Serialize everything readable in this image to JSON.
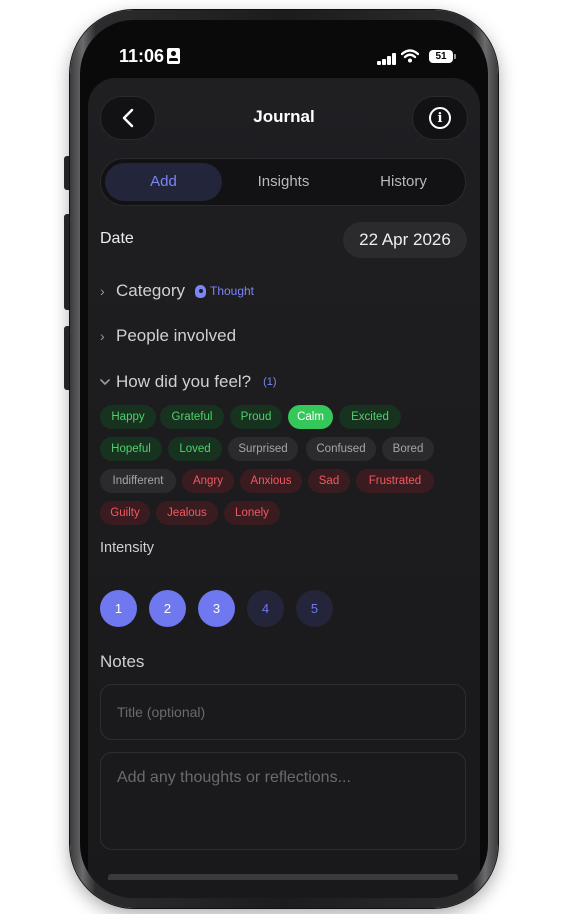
{
  "status_bar": {
    "time": "11:06",
    "battery": "51"
  },
  "header": {
    "title": "Journal"
  },
  "tabs": [
    {
      "label": "Add",
      "active": true
    },
    {
      "label": "Insights",
      "active": false
    },
    {
      "label": "History",
      "active": false
    }
  ],
  "date": {
    "label": "Date",
    "value": "22 Apr 2026"
  },
  "category": {
    "label": "Category",
    "badge": "Thought"
  },
  "people": {
    "label": "People involved"
  },
  "feelings": {
    "label": "How did you feel?",
    "count": "(1)",
    "options": [
      {
        "label": "Happy",
        "tone": "positive",
        "selected": false
      },
      {
        "label": "Grateful",
        "tone": "positive",
        "selected": false
      },
      {
        "label": "Proud",
        "tone": "positive",
        "selected": false
      },
      {
        "label": "Calm",
        "tone": "positive",
        "selected": true
      },
      {
        "label": "Excited",
        "tone": "positive",
        "selected": false
      },
      {
        "label": "Hopeful",
        "tone": "positive",
        "selected": false
      },
      {
        "label": "Loved",
        "tone": "positive",
        "selected": false
      },
      {
        "label": "Surprised",
        "tone": "neutral",
        "selected": false
      },
      {
        "label": "Confused",
        "tone": "neutral",
        "selected": false
      },
      {
        "label": "Bored",
        "tone": "neutral",
        "selected": false
      },
      {
        "label": "Indifferent",
        "tone": "neutral",
        "selected": false
      },
      {
        "label": "Angry",
        "tone": "negative",
        "selected": false
      },
      {
        "label": "Anxious",
        "tone": "negative",
        "selected": false
      },
      {
        "label": "Sad",
        "tone": "negative",
        "selected": false
      },
      {
        "label": "Frustrated",
        "tone": "negative",
        "selected": false
      },
      {
        "label": "Guilty",
        "tone": "negative",
        "selected": false
      },
      {
        "label": "Jealous",
        "tone": "negative",
        "selected": false
      },
      {
        "label": "Lonely",
        "tone": "negative",
        "selected": false
      }
    ]
  },
  "intensity": {
    "label": "Intensity",
    "levels": [
      "1",
      "2",
      "3",
      "4",
      "5"
    ],
    "selected": 3
  },
  "notes": {
    "label": "Notes",
    "title_placeholder": "Title (optional)",
    "body_placeholder": "Add any thoughts or reflections..."
  },
  "colors": {
    "accent": "#6f78ef",
    "positive": "#4fd26d",
    "negative": "#ef5a5f",
    "selected_chip": "#34c759",
    "background": "#1f1f22"
  },
  "icons": [
    "chevron-left-icon",
    "info-icon",
    "chevron-right-icon",
    "chevron-down-icon",
    "thought-icon",
    "signal-icon",
    "wifi-icon",
    "battery-icon",
    "id-card-icon"
  ]
}
